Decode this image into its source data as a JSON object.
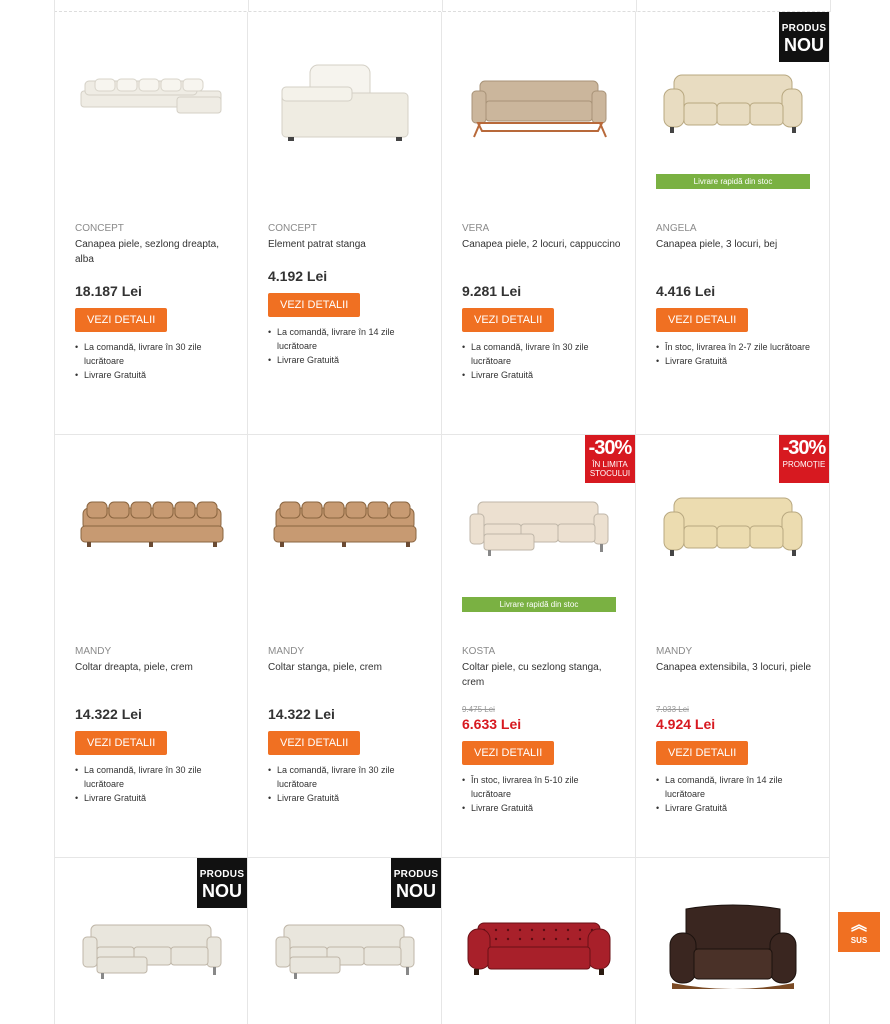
{
  "products": [
    {
      "brand": "CONCEPT",
      "name": "Canapea piele, sezlong dreapta, alba",
      "price": "18.187 Lei",
      "button": "VEZI DETALII",
      "features": [
        "La comandă, livrare în 30 zile lucrătoare",
        "Livrare Gratuită"
      ],
      "color": "#efece4",
      "shape": "corner-long"
    },
    {
      "brand": "CONCEPT",
      "name": "Element patrat stanga",
      "price": "4.192 Lei",
      "button": "VEZI DETALII",
      "features": [
        "La comandă, livrare în 14 zile lucrătoare",
        "Livrare Gratuită"
      ],
      "color": "#efece2",
      "shape": "element"
    },
    {
      "brand": "VERA",
      "name": "Canapea piele, 2 locuri, cappuccino",
      "price": "9.281 Lei",
      "button": "VEZI DETALII",
      "features": [
        "La comandă, livrare în 30 zile lucrătoare",
        "Livrare Gratuită"
      ],
      "color": "#cbb69c",
      "shape": "sofa2"
    },
    {
      "brand": "ANGELA",
      "name": "Canapea piele, 3 locuri, bej",
      "price": "4.416 Lei",
      "button": "VEZI DETALII",
      "features": [
        "În stoc, livrarea în 2-7 zile lucrătoare",
        "Livrare Gratuită"
      ],
      "color": "#e8dcc1",
      "shape": "sofa3",
      "badge_new": {
        "line1": "PRODUS",
        "line2": "NOU"
      },
      "fast": "Livrare rapidă din stoc"
    },
    {
      "brand": "MANDY",
      "name": "Coltar dreapta, piele, crem",
      "price": "14.322 Lei",
      "button": "VEZI DETALII",
      "features": [
        "La comandă, livrare în 30 zile lucrătoare",
        "Livrare Gratuită"
      ],
      "color": "#c79a72",
      "shape": "corner"
    },
    {
      "brand": "MANDY",
      "name": "Coltar stanga, piele, crem",
      "price": "14.322 Lei",
      "button": "VEZI DETALII",
      "features": [
        "La comandă, livrare în 30 zile lucrătoare",
        "Livrare Gratuită"
      ],
      "color": "#c79a72",
      "shape": "corner"
    },
    {
      "brand": "KOSTA",
      "name": "Coltar piele, cu sezlong stanga, crem",
      "old_price": "9.475 Lei",
      "price": "6.633 Lei",
      "button": "VEZI DETALII",
      "features": [
        "În stoc, livrarea în 5-10 zile lucrătoare",
        "Livrare Gratuită"
      ],
      "color": "#ece0d0",
      "shape": "chaise",
      "badge_disc": {
        "pct": "-30%",
        "label": "ÎN LIMITA STOCULUI"
      },
      "fast": "Livrare rapidă din stoc"
    },
    {
      "brand": "MANDY",
      "name": "Canapea extensibila, 3 locuri, piele",
      "old_price": "7.033 Lei",
      "price": "4.924 Lei",
      "button": "VEZI DETALII",
      "features": [
        "La comandă, livrare în 14 zile lucrătoare",
        "Livrare Gratuită"
      ],
      "color": "#ecdcb0",
      "shape": "sofa3",
      "badge_disc": {
        "pct": "-30%",
        "label": "PROMOȚIE"
      }
    },
    {
      "color": "#e9e6dd",
      "shape": "chaise",
      "badge_new": {
        "line1": "PRODUS",
        "line2": "NOU"
      }
    },
    {
      "color": "#e9e6dd",
      "shape": "chaise",
      "badge_new": {
        "line1": "PRODUS",
        "line2": "NOU"
      }
    },
    {
      "color": "#a8202a",
      "shape": "chesterfield"
    },
    {
      "color": "#3a2620",
      "shape": "armchair"
    }
  ],
  "scroll_top": {
    "icon": "double-chevron-up-icon",
    "label": "SUS"
  }
}
